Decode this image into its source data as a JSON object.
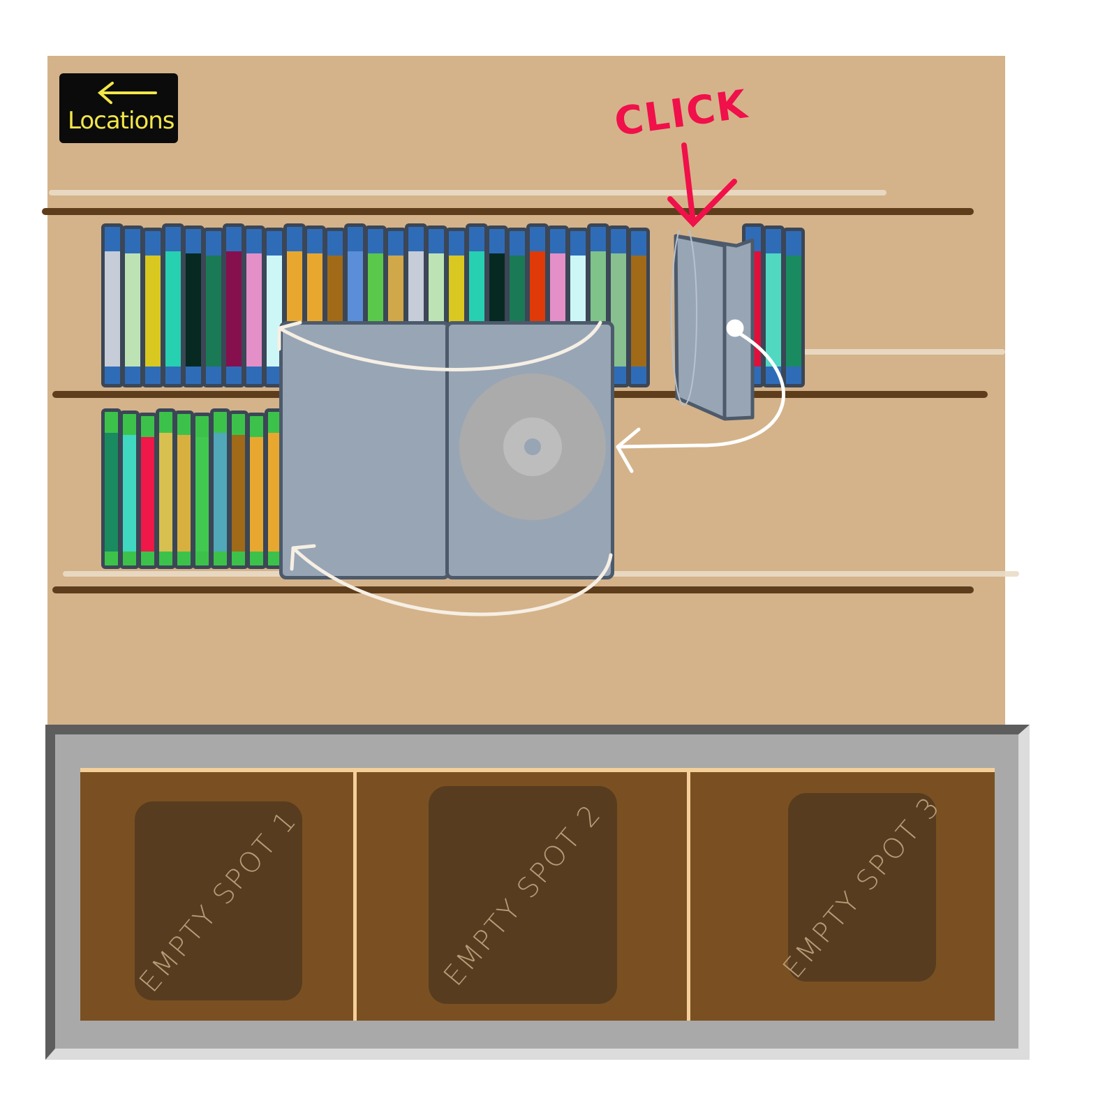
{
  "nav": {
    "back_label": "Locations",
    "back_icon": "arrow-left-icon"
  },
  "hint": {
    "text": "CLICK",
    "color": "#f0104a"
  },
  "colors": {
    "board": "#d4b38a",
    "shelf": "#5e3d1c",
    "case": "#98a5b5",
    "tray": "#a9a9a9",
    "slot": "#7a5022",
    "slot_inner": "#573c1f"
  },
  "shelf_top": {
    "spines": [
      "#c6ccd8",
      "#bde3b5",
      "#d8c820",
      "#26d0b0",
      "#062a22",
      "#1a7a55",
      "#86104e",
      "#e48fc7",
      "#cdf6f6",
      "#e8a830",
      "#e8a830",
      "#a06a18",
      "#5a8ed8",
      "#5ac84a",
      "#d0a84a",
      "#c6ccd8",
      "#bde3b5",
      "#d8c820",
      "#26d0b0",
      "#062a22",
      "#1a7a55",
      "#e03a08",
      "#e48fc7",
      "#cdf6f6",
      "#7fc28a",
      "#88c090",
      "#a06a18",
      "#e0103a",
      "#50d8c0",
      "#1a8a60"
    ]
  },
  "shelf_bottom": {
    "spines": [
      "#1a8a60",
      "#40d8c0",
      "#f01848",
      "#d8c050",
      "#d8b040",
      "#40c850",
      "#50a8b8",
      "#a06a18",
      "#e8a830",
      "#e8a830"
    ]
  },
  "tray": {
    "slots": [
      {
        "label": "EMPTY SPOT 1"
      },
      {
        "label": "EMPTY SPOT 2"
      },
      {
        "label": "EMPTY SPOT 3"
      }
    ]
  }
}
